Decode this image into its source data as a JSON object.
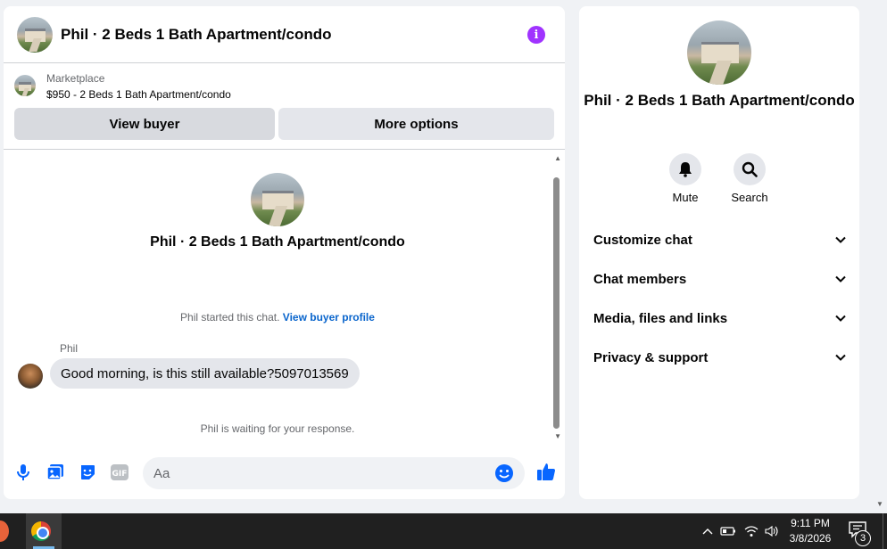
{
  "header": {
    "title": "Phil · 2 Beds 1 Bath Apartment/condo"
  },
  "marketplace": {
    "source": "Marketplace",
    "listing": "$950 - 2 Beds 1 Bath Apartment/condo",
    "view_buyer_label": "View buyer",
    "more_options_label": "More options"
  },
  "thread": {
    "title": "Phil · 2 Beds 1 Bath Apartment/condo",
    "started_text": "Phil started this chat.",
    "view_profile_link": "View buyer profile",
    "sender_name": "Phil",
    "message": "Good morning, is this still available?5097013569",
    "waiting_text": "Phil is waiting for your response."
  },
  "composer": {
    "placeholder": "Aa"
  },
  "side": {
    "title": "Phil · 2 Beds 1 Bath Apartment/condo",
    "mute_label": "Mute",
    "search_label": "Search",
    "sections": [
      "Customize chat",
      "Chat members",
      "Media, files and links",
      "Privacy & support"
    ]
  },
  "taskbar": {
    "time": "9:11 PM",
    "date": "3/8/2026",
    "notification_count": "3"
  },
  "colors": {
    "accent": "#0866ff",
    "info": "#a033ff",
    "link": "#0a65cc"
  }
}
